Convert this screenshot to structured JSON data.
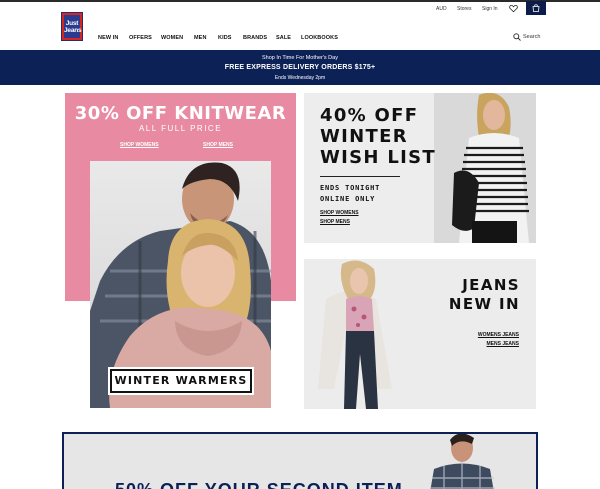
{
  "brand": {
    "logo_text": "Just Jeans",
    "logo_line1": "Just",
    "logo_line2": "Jeans"
  },
  "utility": {
    "currency": "AUD",
    "stores": "Stores",
    "sign_in": "Sign In"
  },
  "nav": {
    "items": [
      "NEW IN",
      "OFFERS",
      "WOMEN",
      "MEN",
      "KIDS",
      "BRANDS",
      "SALE",
      "LOOKBOOKS"
    ],
    "search_label": "Search"
  },
  "promo": {
    "line1": "Shop In Time For Mother's Day",
    "line2": "FREE EXPRESS DELIVERY ORDERS $175+",
    "line3": "Ends Wednesday 2pm"
  },
  "knitwear": {
    "title": "30% OFF KNITWEAR",
    "subtitle": "ALL FULL PRICE",
    "link_womens": "SHOP WOMENS",
    "link_mens": "SHOP MENS",
    "label": "WINTER WARMERS"
  },
  "wishlist": {
    "title_lines": [
      "40% OFF",
      "WINTER",
      "WISH LIST"
    ],
    "sub_lines": [
      "ENDS TONIGHT",
      "ONLINE ONLY"
    ],
    "link_womens": "SHOP WOMENS",
    "link_mens": "SHOP MENS"
  },
  "jeans": {
    "title_lines": [
      "JEANS",
      "NEW IN"
    ],
    "link_womens": "WOMENS JEANS",
    "link_mens": "MENS JEANS"
  },
  "bottom_banner": {
    "text": "50% OFF YOUR SECOND ITEM"
  },
  "colors": {
    "navy": "#0c2257",
    "pink": "#e98aa3",
    "brand_red": "#d7261e"
  },
  "icons": [
    "heart-icon",
    "cart-icon",
    "search-icon"
  ]
}
